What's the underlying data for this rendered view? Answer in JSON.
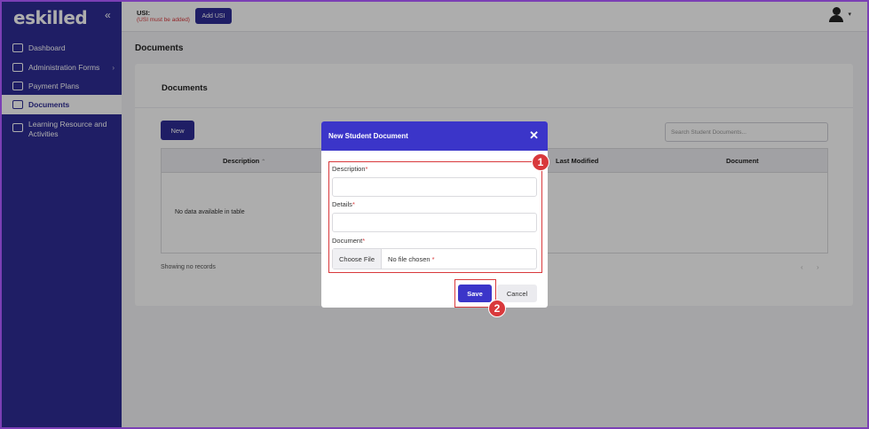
{
  "sidebar": {
    "logo": "eskilled",
    "collapse_icon": "«",
    "items": [
      {
        "label": "Dashboard",
        "icon": "chart-icon"
      },
      {
        "label": "Administration Forms",
        "icon": "forms-icon",
        "chevron": "›"
      },
      {
        "label": "Payment Plans",
        "icon": "card-icon"
      },
      {
        "label": "Documents",
        "icon": "document-icon",
        "active": true
      },
      {
        "label": "Learning Resource and Activities",
        "icon": "learning-icon"
      }
    ]
  },
  "topbar": {
    "usi_label": "USI:",
    "usi_warning": "(USI must be added)",
    "add_usi_label": "Add USI",
    "user_caret": "▾"
  },
  "main": {
    "page_title": "Documents",
    "card_title": "Documents",
    "new_label": "New",
    "search_placeholder": "Search Student Documents...",
    "columns": [
      "Description",
      "Last Modified",
      "Document"
    ],
    "sort_indicator": "⌃",
    "empty_text": "No data available in table",
    "showing_text": "Showing no records",
    "pager_prev": "‹",
    "pager_next": "›"
  },
  "modal": {
    "title": "New Student Document",
    "close_icon": "✕",
    "description_label": "Description",
    "details_label": "Details",
    "document_label": "Document",
    "required_mark": "*",
    "choose_file_label": "Choose File",
    "no_file_text": "No file chosen",
    "save_label": "Save",
    "cancel_label": "Cancel"
  },
  "annotations": {
    "step1": "1",
    "step2": "2",
    "color": "#d9393c"
  },
  "colors": {
    "sidebar": "#2f2d96",
    "modal_header": "#3b35c9",
    "accent_red": "#d9393c"
  }
}
